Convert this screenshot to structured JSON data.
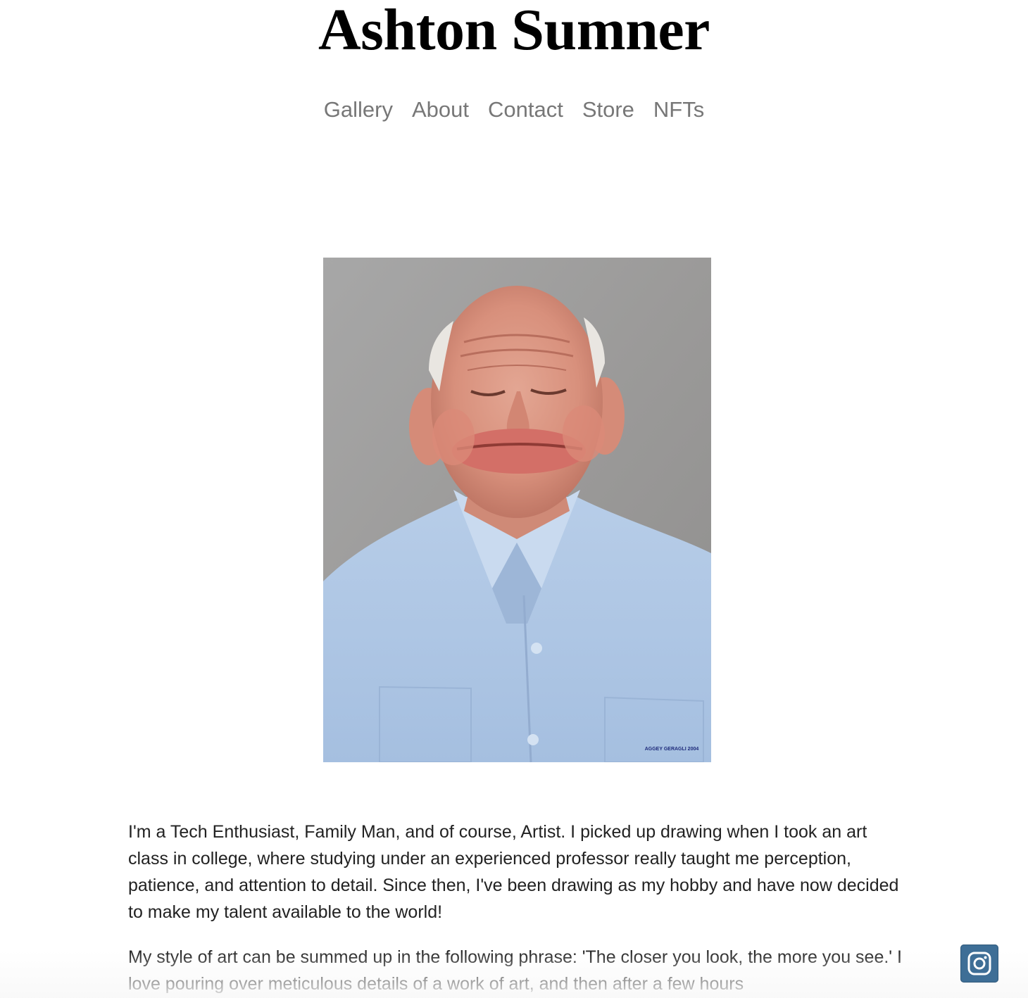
{
  "header": {
    "site_title": "Ashton Sumner"
  },
  "nav": {
    "items": [
      {
        "label": "Gallery"
      },
      {
        "label": "About"
      },
      {
        "label": "Contact"
      },
      {
        "label": "Store"
      },
      {
        "label": "NFTs"
      }
    ]
  },
  "portrait": {
    "watermark": "AGGEY GERAGLI 2004"
  },
  "bio": {
    "paragraphs": [
      "I'm a Tech Enthusiast, Family Man, and of course, Artist. I picked up drawing when I took an art class in college, where studying under an experienced professor really taught me perception, patience, and attention to detail. Since then, I've been drawing as my hobby and have now decided to make my talent available to the world!",
      "My style of art can be summed up in the following phrase: 'The closer you look, the more you see.' I love pouring over meticulous details of a work of art, and then after a few hours"
    ]
  },
  "social": {
    "instagram_icon": "instagram-icon",
    "colors": {
      "background": "#3e6e96"
    }
  },
  "colors": {
    "nav_link": "#777777",
    "title": "#000000",
    "body_text": "#222222"
  }
}
